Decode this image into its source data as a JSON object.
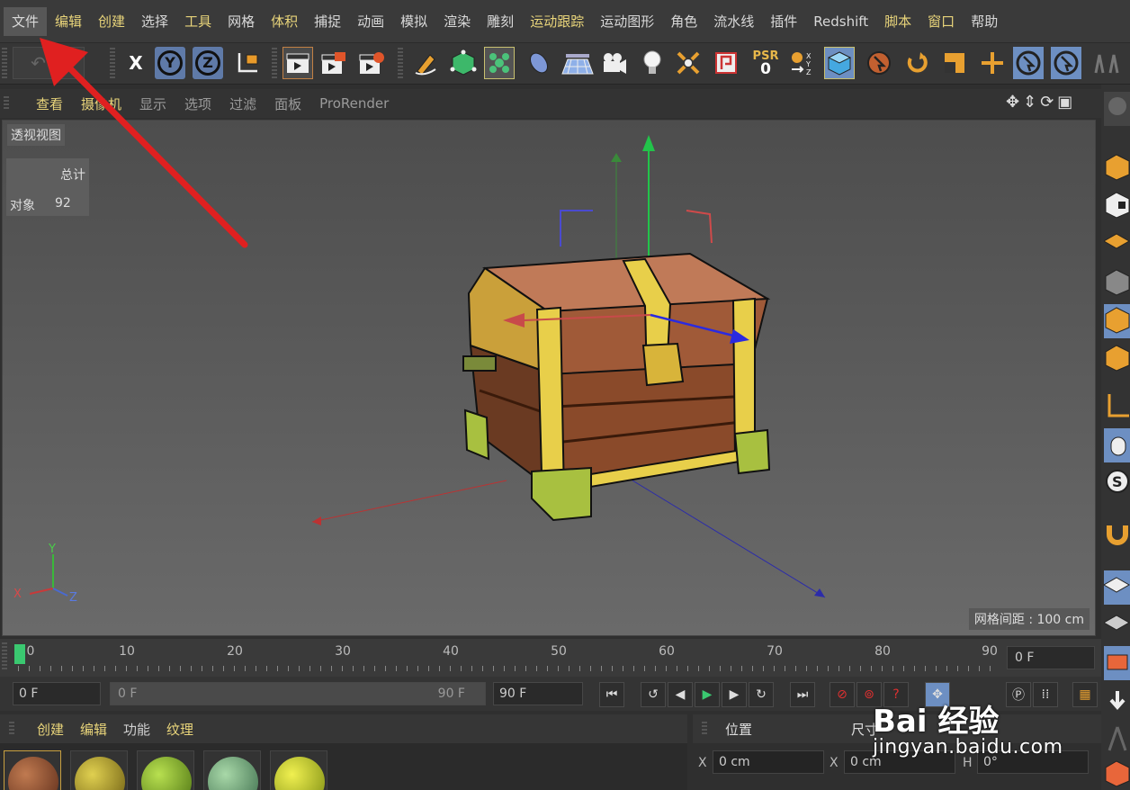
{
  "menubar": {
    "items": [
      "文件",
      "编辑",
      "创建",
      "选择",
      "工具",
      "网格",
      "体积",
      "捕捉",
      "动画",
      "模拟",
      "渲染",
      "雕刻",
      "运动跟踪",
      "运动图形",
      "角色",
      "流水线",
      "插件",
      "Redshift",
      "脚本",
      "窗口",
      "帮助"
    ]
  },
  "toolbar": {
    "axis_x": "X",
    "axis_y": "Y",
    "axis_z": "Z",
    "psr_label": "PSR",
    "psr_value": "0"
  },
  "viewport_menu": {
    "items": [
      "查看",
      "摄像机",
      "显示",
      "选项",
      "过滤",
      "面板",
      "ProRender"
    ]
  },
  "viewport": {
    "label": "透视视图",
    "info_header": "总计",
    "info_key": "对象",
    "info_value": "92",
    "grid_spacing": "网格间距 : 100 cm",
    "axis_labels": {
      "x": "X",
      "y": "Y",
      "z": "Z"
    }
  },
  "timeline": {
    "ticks": [
      "0",
      "10",
      "20",
      "30",
      "40",
      "50",
      "60",
      "70",
      "80",
      "90"
    ],
    "current_frame": "0 F"
  },
  "transport": {
    "start_field": "0 F",
    "range_start": "0 F",
    "range_end": "90 F",
    "end_field": "90 F"
  },
  "material_menu": {
    "items": [
      "创建",
      "编辑",
      "功能",
      "纹理"
    ]
  },
  "properties": {
    "position_label": "位置",
    "size_label": "尺寸",
    "x_label": "X",
    "x_value": "0 cm",
    "size_x_label": "X",
    "size_x_value": "0 cm",
    "h_label": "H",
    "h_value": "0°"
  },
  "watermark": {
    "logo": "Bai 经验",
    "url": "jingyan.baidu.com"
  },
  "colors": {
    "accent_yellow": "#e8d47a",
    "active_blue": "#6d8fc2",
    "annotation_red": "#e02020"
  }
}
